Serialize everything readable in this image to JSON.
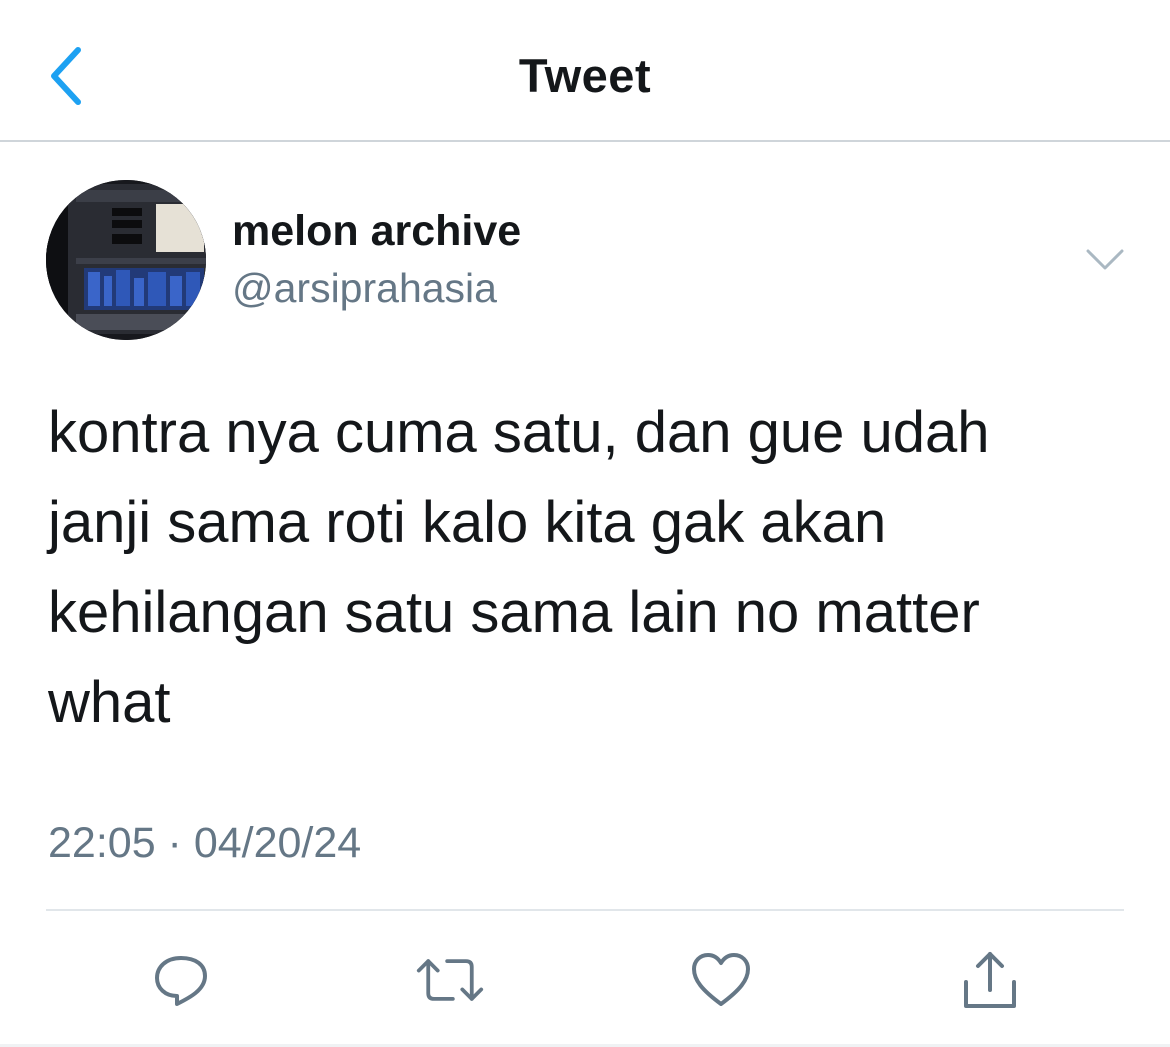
{
  "header": {
    "title": "Tweet",
    "back_icon": "chevron-left-icon"
  },
  "tweet": {
    "author": {
      "display_name": "melon archive",
      "handle": "@arsiprahasia"
    },
    "text": "kontra nya cuma satu, dan gue udah janji sama roti kalo kita gak akan kehilangan satu sama lain no matter what",
    "timestamp": "22:05 · 04/20/24"
  },
  "actions": [
    {
      "icon": "reply-icon"
    },
    {
      "icon": "retweet-icon"
    },
    {
      "icon": "like-icon"
    },
    {
      "icon": "share-icon"
    }
  ],
  "colors": {
    "accent": "#1da1f2",
    "text_primary": "#14171a",
    "text_secondary": "#657786",
    "divider": "#cfd5da"
  }
}
